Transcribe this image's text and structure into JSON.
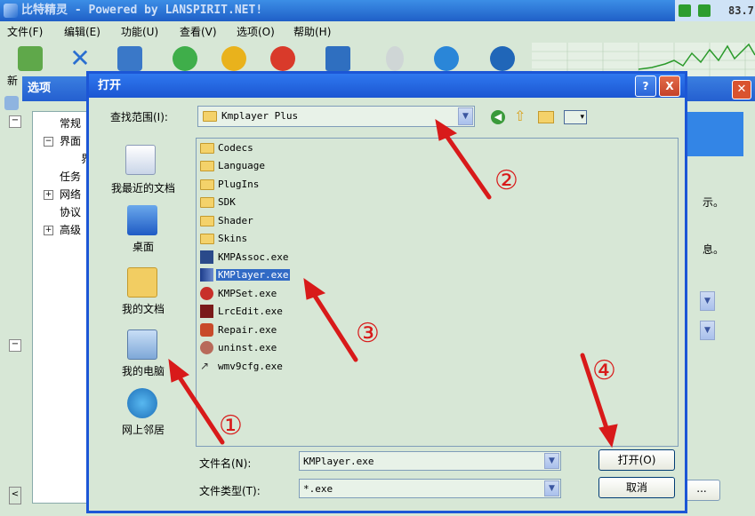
{
  "app": {
    "title": "比特精灵 - Powered by LANSPIRIT.NET!",
    "tray_value": "83.7",
    "menu": [
      "文件(F)",
      "编辑(E)",
      "功能(U)",
      "查看(V)",
      "选项(O)",
      "帮助(H)"
    ],
    "toolbar_new_label": "新"
  },
  "options_window": {
    "title": "选项",
    "tree_items": [
      "常规",
      "界面",
      "界",
      "任务",
      "网络",
      "协议",
      "高级"
    ],
    "side_text_1": "示。",
    "side_text_2": "息。",
    "ellipsis_label": "..."
  },
  "dialog": {
    "title": "打开",
    "help_label": "?",
    "close_label": "X",
    "look_in_label": "查找范围(I):",
    "look_in_value": "Kmplayer Plus",
    "places": [
      {
        "label": "我最近的文档",
        "icon": "recent-documents-icon"
      },
      {
        "label": "桌面",
        "icon": "desktop-icon"
      },
      {
        "label": "我的文档",
        "icon": "my-documents-icon"
      },
      {
        "label": "我的电脑",
        "icon": "my-computer-icon"
      },
      {
        "label": "网上邻居",
        "icon": "network-places-icon"
      }
    ],
    "files": [
      {
        "name": "Codecs",
        "type": "folder"
      },
      {
        "name": "Language",
        "type": "folder"
      },
      {
        "name": "PlugIns",
        "type": "folder"
      },
      {
        "name": "SDK",
        "type": "folder"
      },
      {
        "name": "Shader",
        "type": "folder"
      },
      {
        "name": "Skins",
        "type": "folder"
      },
      {
        "name": "KMPAssoc.exe",
        "type": "exe"
      },
      {
        "name": "KMPlayer.exe",
        "type": "exe",
        "selected": true
      },
      {
        "name": "KMPSet.exe",
        "type": "exe"
      },
      {
        "name": "LrcEdit.exe",
        "type": "exe"
      },
      {
        "name": "Repair.exe",
        "type": "exe"
      },
      {
        "name": "uninst.exe",
        "type": "exe"
      },
      {
        "name": "wmv9cfg.exe",
        "type": "exe"
      }
    ],
    "filename_label": "文件名(N):",
    "filename_value": "KMPlayer.exe",
    "filetype_label": "文件类型(T):",
    "filetype_value": "*.exe",
    "open_button": "打开(O)",
    "cancel_button": "取消"
  },
  "annotations": [
    "①",
    "②",
    "③",
    "④"
  ],
  "colors": {
    "arrow": "#d81a1a",
    "selection": "#316ac5",
    "titlebar": "#1b56d2"
  }
}
